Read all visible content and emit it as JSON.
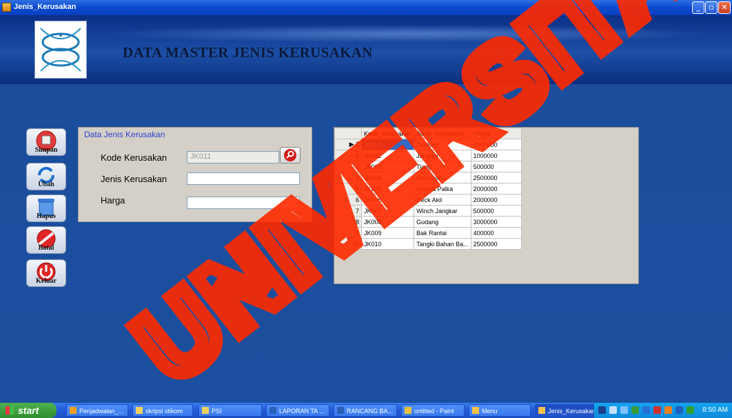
{
  "window": {
    "title": "Jenis_Kerusakan"
  },
  "banner": {
    "heading": "DATA MASTER JENIS KERUSAKAN"
  },
  "sidebar": {
    "buttons": [
      {
        "label": "Simpan",
        "icon": "save-icon"
      },
      {
        "label": "Ubah",
        "icon": "refresh-icon"
      },
      {
        "label": "Hapus",
        "icon": "trash-icon"
      },
      {
        "label": "Batal",
        "icon": "cancel-icon"
      },
      {
        "label": "Keluar",
        "icon": "power-icon"
      }
    ]
  },
  "form": {
    "group_title": "Data Jenis Kerusakan",
    "kode_label": "Kode Kerusakan",
    "kode_value": "JK011",
    "jenis_label": "Jenis Kerusakan",
    "jenis_value": "",
    "harga_label": "Harga",
    "harga_value": ""
  },
  "grid": {
    "columns": [
      "Kode_Kerusakan",
      "Jenis_Kerusakan",
      "Harga"
    ],
    "rows": [
      {
        "n": "1",
        "kode": "JK001",
        "jenis": "Docking",
        "harga": "2000000"
      },
      {
        "n": "2",
        "kode": "JK002",
        "jenis": "Jangkar",
        "harga": "1000000"
      },
      {
        "n": "3",
        "kode": "JK003",
        "jenis": "Tiang",
        "harga": "500000"
      },
      {
        "n": "4",
        "kode": "JK004",
        "jenis": "Anjungan",
        "harga": "2500000"
      },
      {
        "n": "5",
        "kode": "JK005",
        "jenis": "Kepala Palka",
        "harga": "2000000"
      },
      {
        "n": "6",
        "kode": "JK006",
        "jenis": "Deck Akil",
        "harga": "2000000"
      },
      {
        "n": "7",
        "kode": "JK007",
        "jenis": "Winch Jangkar",
        "harga": "500000"
      },
      {
        "n": "8",
        "kode": "JK008",
        "jenis": "Gudang",
        "harga": "3000000"
      },
      {
        "n": "9",
        "kode": "JK009",
        "jenis": "Bak Rantai",
        "harga": "400000"
      },
      {
        "n": "10",
        "kode": "JK010",
        "jenis": "Tangki Bahan Ba...",
        "harga": "2500000"
      }
    ]
  },
  "taskbar": {
    "start_label": "start",
    "tasks": [
      "Penjadwalan_...",
      "skripsi stikom",
      "PSI",
      "LAPORAN TA ...",
      "RANCANG BA...",
      "untitled - Paint",
      "Menu",
      "Jenis_Kerusakan"
    ],
    "clock": "8:50 AM"
  },
  "watermark": {
    "text": "UNIVERSITAS SURABAYA",
    "color": "#ff2a00"
  },
  "colors": {
    "titlebar": "#0a49d0",
    "banner": "#1c4fa7",
    "background": "#1a4f9a",
    "selection": "#316ac5"
  }
}
